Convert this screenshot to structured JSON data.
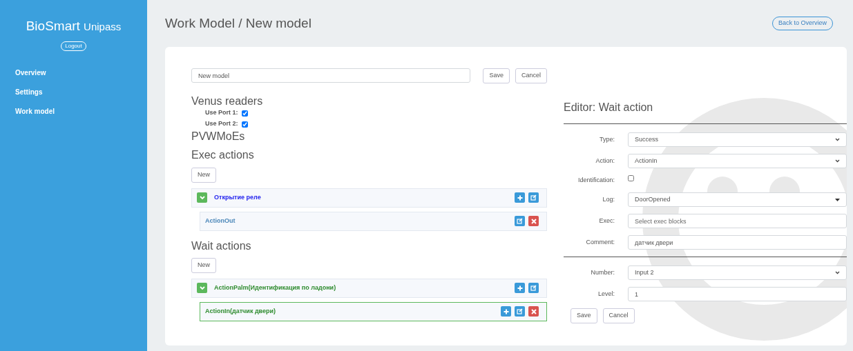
{
  "sidebar": {
    "brand": "BioSmart",
    "brand_sub": "Unipass",
    "logout": "Logout",
    "items": [
      {
        "label": "Overview"
      },
      {
        "label": "Settings"
      },
      {
        "label": "Work model"
      }
    ]
  },
  "header": {
    "title": "Work Model / New model",
    "back_button": "Back to Overview"
  },
  "model": {
    "name": "New model",
    "buttons": [
      "Save",
      "Cancel"
    ]
  },
  "venus_readers": {
    "heading": "Venus readers",
    "ports": [
      {
        "label": "Use Port 1:",
        "checked": true
      },
      {
        "label": "Use Port 2:",
        "checked": true
      }
    ]
  },
  "pvwmoes": {
    "heading": "PVWMoEs"
  },
  "exec_actions": {
    "heading": "Exec actions",
    "new_button": "New",
    "groups": [
      {
        "label": "Открытие реле",
        "color": "#2222ee",
        "expanded": true,
        "buttons": [
          {
            "kind": "add"
          },
          {
            "kind": "edit"
          }
        ],
        "children": [
          {
            "label": "ActionOut",
            "color": "#4a86b8",
            "selected": false,
            "buttons": [
              {
                "kind": "edit"
              },
              {
                "kind": "delete"
              }
            ]
          }
        ]
      }
    ]
  },
  "wait_actions": {
    "heading": "Wait actions",
    "new_button": "New",
    "groups": [
      {
        "label": "ActionPalm(Идентификация по ладони)",
        "color": "#2e8b2e",
        "expanded": true,
        "buttons": [
          {
            "kind": "add"
          },
          {
            "kind": "edit"
          }
        ],
        "children": [
          {
            "label": "ActionIn(датчик двери)",
            "color": "#2e8b2e",
            "selected": true,
            "buttons": [
              {
                "kind": "add"
              },
              {
                "kind": "edit"
              },
              {
                "kind": "delete"
              }
            ]
          }
        ]
      }
    ]
  },
  "editor": {
    "title": "Editor: Wait action",
    "sections": [
      [
        {
          "kind": "select",
          "label": "Type:",
          "value": "Success"
        },
        {
          "kind": "select",
          "label": "Action:",
          "value": "ActionIn"
        },
        {
          "kind": "checkbox",
          "label": "Identification:",
          "checked": false
        },
        {
          "kind": "dropdown",
          "label": "Log:",
          "value": "DoorOpened"
        },
        {
          "kind": "text",
          "label": "Exec:",
          "placeholder": "Select exec blocks"
        },
        {
          "kind": "text",
          "label": "Comment:",
          "value": "датчик двери"
        }
      ],
      [
        {
          "kind": "select",
          "label": "Number:",
          "value": "Input 2"
        },
        {
          "kind": "text",
          "label": "Level:",
          "value": "1"
        }
      ]
    ],
    "buttons": [
      "Save",
      "Cancel"
    ]
  }
}
